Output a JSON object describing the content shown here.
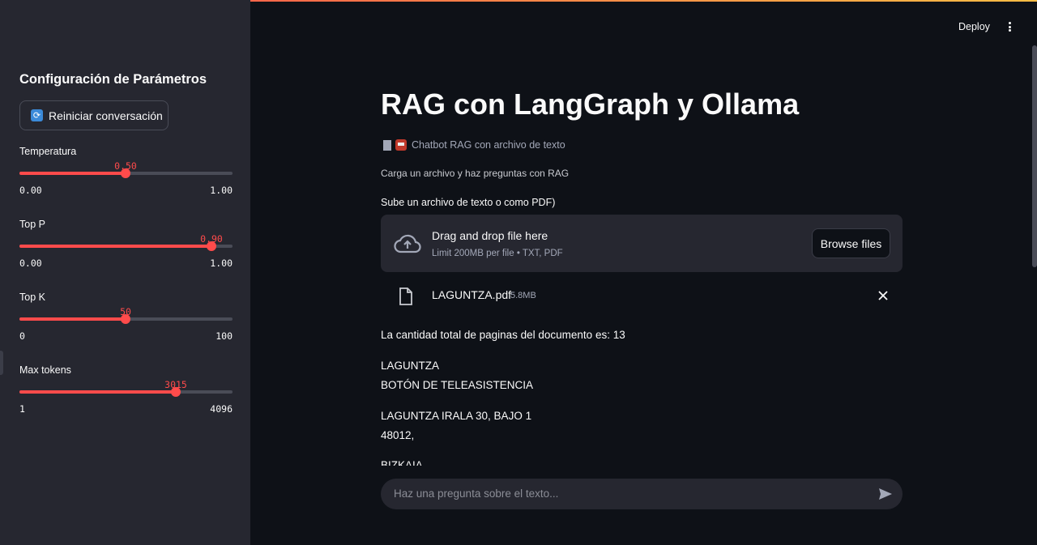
{
  "sidebar": {
    "title": "Configuración de Parámetros",
    "reset_label": "Reiniciar conversación",
    "sliders": [
      {
        "label": "Temperatura",
        "value": "0.50",
        "min": "0.00",
        "max": "1.00",
        "fraction": 0.5
      },
      {
        "label": "Top P",
        "value": "0.90",
        "min": "0.00",
        "max": "1.00",
        "fraction": 0.9
      },
      {
        "label": "Top K",
        "value": "50",
        "min": "0",
        "max": "100",
        "fraction": 0.5
      },
      {
        "label": "Max tokens",
        "value": "3015",
        "min": "1",
        "max": "4096",
        "fraction": 0.736
      }
    ]
  },
  "header": {
    "deploy_label": "Deploy",
    "menu_icon": "kebab-menu-icon"
  },
  "main": {
    "title": "RAG con LangGraph y Ollama",
    "caption": "Chatbot RAG con archivo de texto",
    "subtitle": "Carga un archivo y haz preguntas con RAG",
    "uploader_label": "Sube un archivo de texto o como PDF)",
    "dropzone": {
      "title": "Drag and drop file here",
      "limit": "Limit 200MB per file • TXT, PDF",
      "browse_label": "Browse files"
    },
    "file": {
      "name": "LAGUNTZA.pdf",
      "size": "5.8MB"
    },
    "page_count_text": "La cantidad total de paginas del documento es: 13",
    "doc_lines": [
      "LAGUNTZA",
      "BOTÓN DE TELEASISTENCIA",
      "LAGUNTZA IRALA 30, BAJO 1",
      "48012,",
      "BIZKAIA"
    ],
    "chat_placeholder": "Haz una pregunta sobre el texto..."
  },
  "colors": {
    "accent": "#ff4b4b",
    "sidebar_bg": "#262730",
    "main_bg": "#0e1117"
  }
}
